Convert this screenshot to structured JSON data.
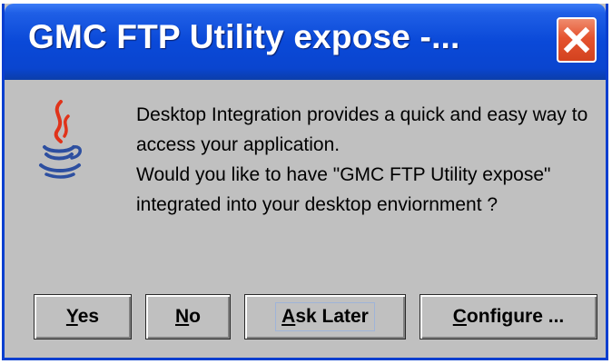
{
  "window": {
    "title": "GMC FTP Utility expose -..."
  },
  "icons": {
    "close": "close-icon",
    "app": "java-coffee-cup-icon"
  },
  "message": {
    "line1": "Desktop Integration provides a quick and easy way to access your application.",
    "line2": "Would you like to have  \"GMC FTP Utility expose\" integrated into your desktop enviornment ?"
  },
  "buttons": {
    "yes": {
      "mnemonic": "Y",
      "rest": "es"
    },
    "no": {
      "mnemonic": "N",
      "rest": "o"
    },
    "ask_later": {
      "mnemonic": "A",
      "rest": "sk Later"
    },
    "configure": {
      "mnemonic": "C",
      "rest": "onfigure ..."
    }
  },
  "colors": {
    "titlebar": "#0a49d8",
    "close_button": "#e5532f",
    "dialog_background": "#c0c0c0"
  }
}
